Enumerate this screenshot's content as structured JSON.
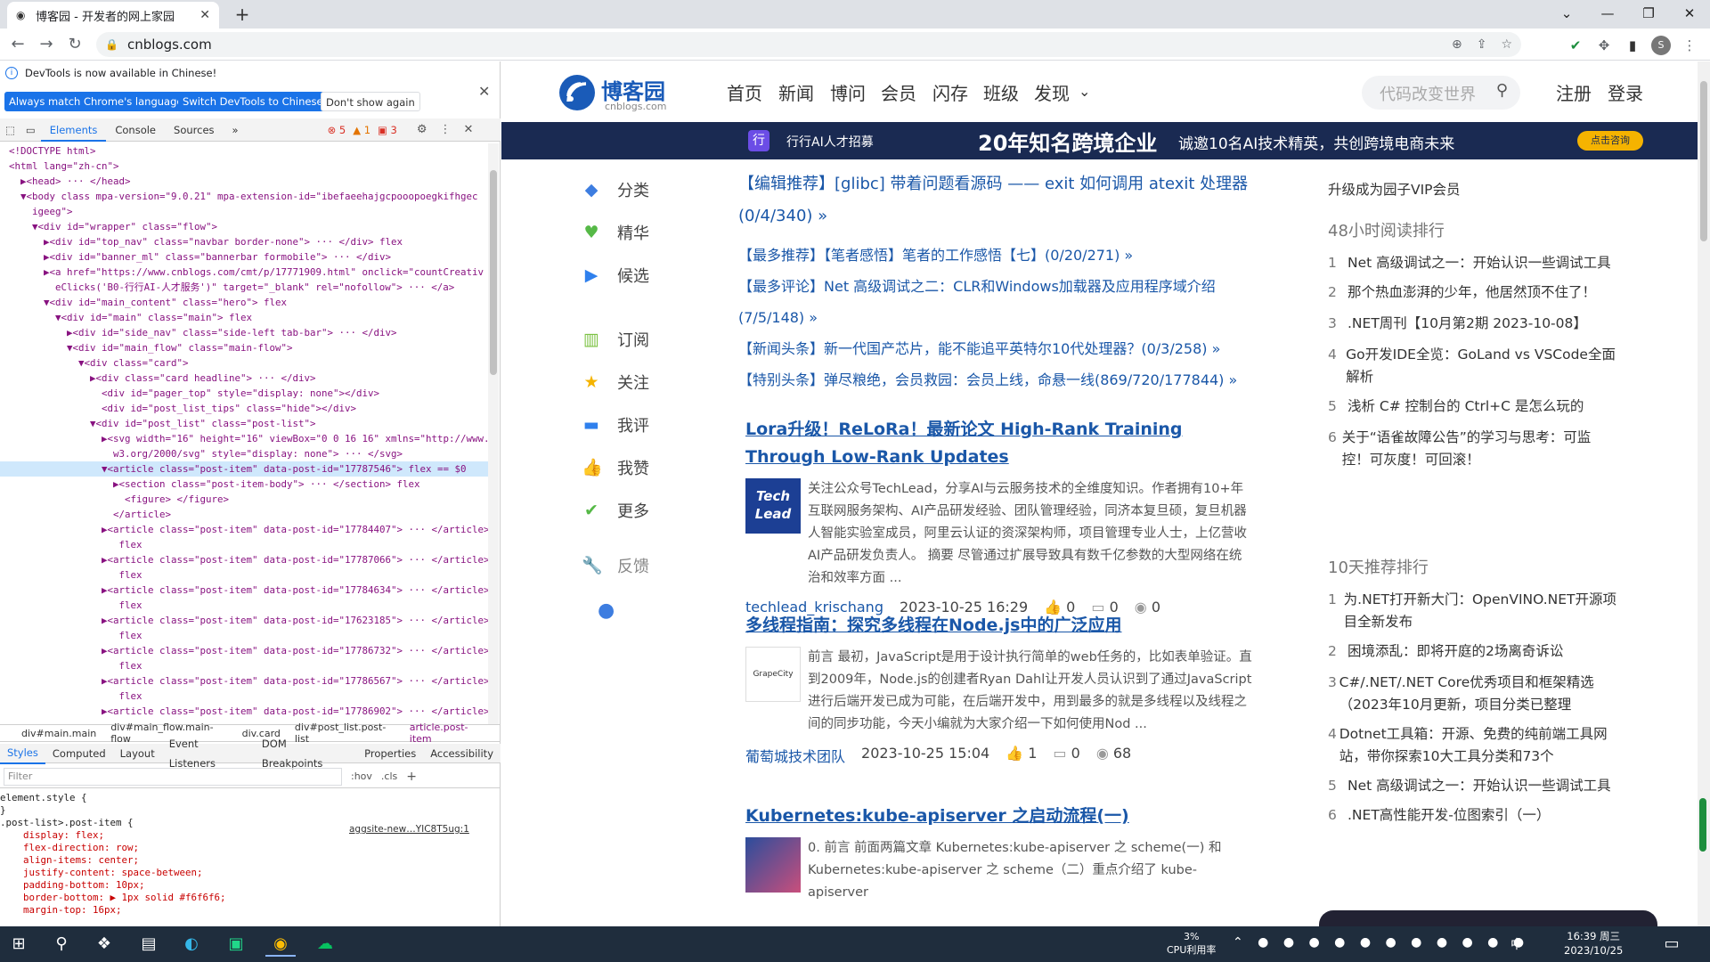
{
  "browser": {
    "tab_title": "博客园 - 开发者的网上家园",
    "url": "cnblogs.com",
    "profile_initial": "S"
  },
  "devtools": {
    "info_text": "DevTools is now available in Chinese!",
    "btn_match": "Always match Chrome's language",
    "btn_switch": "Switch DevTools to Chinese",
    "btn_dont": "Don't show again",
    "tabs": [
      "Elements",
      "Console",
      "Sources",
      "»"
    ],
    "counts": {
      "errors": "5",
      "warnings": "1",
      "issues": "3"
    },
    "dom_lines": [
      "<!DOCTYPE html>",
      "<html lang=\"zh-cn\">",
      "  ▶<head> ··· </head>",
      "  ▼<body class mpa-version=\"9.0.21\" mpa-extension-id=\"ibefaeehajgcpooopoegkifhgec",
      "    igeeg\">",
      "    ▼<div id=\"wrapper\" class=\"flow\">",
      "      ▶<div id=\"top_nav\" class=\"navbar border-none\"> ··· </div> flex",
      "      ▶<div id=\"banner_ml\" class=\"bannerbar formobile\"> ··· </div>",
      "      ▶<a href=\"https://www.cnblogs.com/cmt/p/17771909.html\" onclick=\"countCreativ",
      "        eClicks('B0-行行AI-人才服务')\" target=\"_blank\" rel=\"nofollow\"> ··· </a>",
      "      ▼<div id=\"main_content\" class=\"hero\"> flex",
      "        ▼<div id=\"main\" class=\"main\"> flex",
      "          ▶<div id=\"side_nav\" class=\"side-left tab-bar\"> ··· </div>",
      "          ▼<div id=\"main_flow\" class=\"main-flow\">",
      "            ▼<div class=\"card\">",
      "              ▶<div class=\"card headline\"> ··· </div>",
      "                <div id=\"pager_top\" style=\"display: none\"></div>",
      "                <div id=\"post_list_tips\" class=\"hide\"></div>",
      "              ▼<div id=\"post_list\" class=\"post-list\">",
      "                ▶<svg width=\"16\" height=\"16\" viewBox=\"0 0 16 16\" xmlns=\"http://www.",
      "                  w3.org/2000/svg\" style=\"display: none\"> ··· </svg>",
      "                ▼<article class=\"post-item\" data-post-id=\"17787546\"> flex == $0",
      "                  ▶<section class=\"post-item-body\"> ··· </section> flex",
      "                    <figure> </figure>",
      "                  </article>",
      "                ▶<article class=\"post-item\" data-post-id=\"17784407\"> ··· </article>",
      "                   flex",
      "                ▶<article class=\"post-item\" data-post-id=\"17787066\"> ··· </article>",
      "                   flex",
      "                ▶<article class=\"post-item\" data-post-id=\"17784634\"> ··· </article>",
      "                   flex",
      "                ▶<article class=\"post-item\" data-post-id=\"17623185\"> ··· </article>",
      "                   flex",
      "                ▶<article class=\"post-item\" data-post-id=\"17786732\"> ··· </article>",
      "                   flex",
      "                ▶<article class=\"post-item\" data-post-id=\"17786567\"> ··· </article>",
      "                   flex",
      "                ▶<article class=\"post-item\" data-post-id=\"17786902\"> ··· </article>"
    ],
    "selected_line_index": 21,
    "breadcrumbs": [
      "div#main.main",
      "div#main_flow.main-flow",
      "div.card",
      "div#post_list.post-list",
      "article.post-item"
    ],
    "subtabs": [
      "Styles",
      "Computed",
      "Layout",
      "Event Listeners",
      "DOM Breakpoints",
      "Properties",
      "Accessibility"
    ],
    "filter_placeholder": "Filter",
    "filter_tools": [
      ":hov",
      ".cls",
      "+"
    ],
    "style_lines": [
      "element.style {",
      "}",
      ".post-list>.post-item {",
      "    display: flex;",
      "    flex-direction: row;",
      "    align-items: center;",
      "    justify-content: space-between;",
      "    padding-bottom: 10px;",
      "    border-bottom: ▶ 1px solid #f6f6f6;",
      "    margin-top: 16px;"
    ],
    "style_source": "aggsite-new…YIC8T5ug:1"
  },
  "site": {
    "logo_cn": "博客园",
    "logo_en": "cnblogs.com",
    "nav": [
      "首页",
      "新闻",
      "博问",
      "会员",
      "闪存",
      "班级",
      "发现"
    ],
    "search_placeholder": "代码改变世界",
    "register": "注册",
    "login": "登录",
    "banner": {
      "badge": "行",
      "brand": "行行AI人才招募",
      "headline": "20年知名跨境企业",
      "sub": "诚邀10名AI技术精英，共创跨境电商未来",
      "cta": "点击咨询"
    },
    "side_nav": [
      "分类",
      "精华",
      "候选",
      "订阅",
      "关注",
      "我评",
      "我赞",
      "更多",
      "反馈"
    ],
    "headlines": [
      "【编辑推荐】[glibc] 带着问题看源码 —— exit 如何调用 atexit 处理器 (0/4/340) »",
      "【最多推荐】【笔者感悟】笔者的工作感悟【七】(0/20/271) »",
      "【最多评论】Net 高级调试之二：CLR和Windows加载器及应用程序域介绍(7/5/148) »",
      "【新闻头条】新一代国产芯片，能不能追平英特尔10代处理器？(0/3/258) »",
      "【特别头条】弹尽粮绝，会员救园：会员上线，命悬一线(869/720/177844) »"
    ],
    "posts": [
      {
        "title": "Lora升级！ReLoRa！最新论文 High-Rank Training Through Low-Rank Updates",
        "thumb": "Tech Lead",
        "summary": "关注公众号TechLead，分享AI与云服务技术的全维度知识。作者拥有10+年互联网服务架构、AI产品研发经验、团队管理经验，同济本复旦硕，复旦机器人智能实验室成员，阿里云认证的资深架构师，项目管理专业人士，上亿营收AI产品研发负责人。 摘要 尽管通过扩展导致具有数千亿参数的大型网络在统治和效率方面 ...",
        "author": "techlead_krischang",
        "date": "2023-10-25 16:29",
        "likes": "0",
        "comments": "0",
        "views": "0"
      },
      {
        "title": "多线程指南：探究多线程在Node.js中的广泛应用",
        "thumb": "GrapeCity",
        "summary": "前言 最初，JavaScript是用于设计执行简单的web任务的，比如表单验证。直到2009年，Node.js的创建者Ryan Dahl让开发人员认识到了通过JavaScript 进行后端开发已成为可能，在后端开发中，用到最多的就是多线程以及线程之间的同步功能，今天小编就为大家介绍一下如何使用Nod ...",
        "author": "葡萄城技术团队",
        "date": "2023-10-25 15:04",
        "likes": "1",
        "comments": "0",
        "views": "68"
      },
      {
        "title": "Kubernetes:kube-apiserver 之启动流程(一)",
        "thumb": "",
        "summary": "0. 前言 前面两篇文章 Kubernetes:kube-apiserver 之 scheme(一) 和 Kubernetes:kube-apiserver 之 scheme（二）重点介绍了 kube-apiserver",
        "author": "",
        "date": "",
        "likes": "",
        "comments": "",
        "views": ""
      }
    ],
    "vip": "升级成为园子VIP会员",
    "rank48_title": "48小时阅读排行",
    "rank48": [
      "Net 高级调试之一：开始认识一些调试工具",
      "那个热血澎湃的少年，他居然顶不住了！",
      ".NET周刊【10月第2期 2023-10-08】",
      "Go开发IDE全览：GoLand vs VSCode全面解析",
      "浅析 C# 控制台的 Ctrl+C 是怎么玩的",
      "关于“语雀故障公告”的学习与思考：可监控！可灰度！可回滚！"
    ],
    "rank10_title": "10天推荐排行",
    "rank10": [
      "为.NET打开新大门：OpenVINO.NET开源项目全新发布",
      "困境添乱：即将开庭的2场离奇诉讼",
      "C#/.NET/.NET Core优秀项目和框架精选（2023年10月更新，项目分类已整理",
      "Dotnet工具箱：开源、免费的纯前端工具网站，带你探索10大工具分类和73个",
      "Net 高级调试之一：开始认识一些调试工具",
      ".NET高性能开发-位图索引（一）"
    ]
  },
  "taskbar": {
    "cpu_pct": "3%",
    "cpu_label": "CPU利用率",
    "ime": "中",
    "time": "16:39 周三",
    "date": "2023/10/25"
  }
}
